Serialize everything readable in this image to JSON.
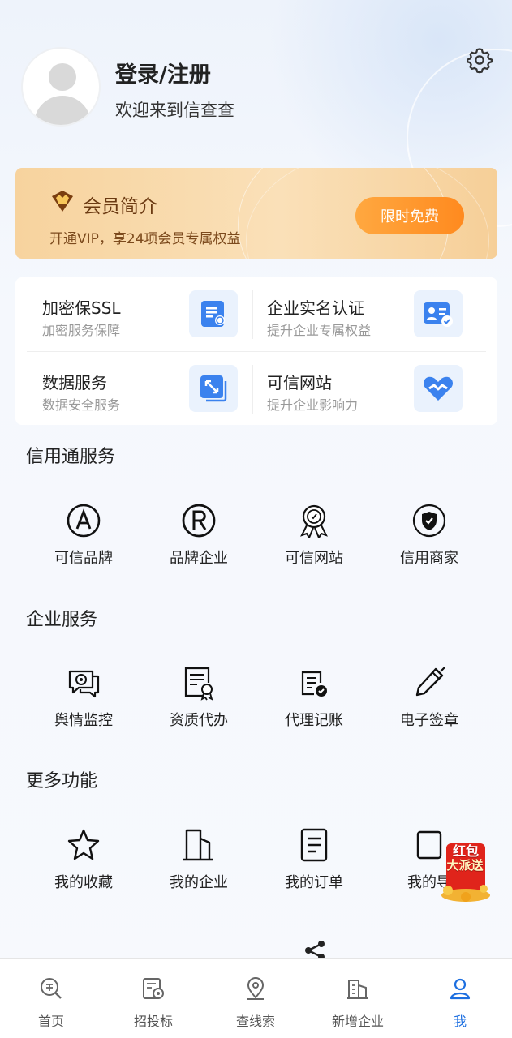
{
  "header": {
    "login_title": "登录/注册",
    "welcome": "欢迎来到信查查"
  },
  "vip": {
    "title": "会员简介",
    "subtitle": "开通VIP，享24项会员专属权益",
    "button": "限时免费"
  },
  "services": [
    {
      "title": "加密保SSL",
      "subtitle": "加密服务保障",
      "icon": "ssl-document-icon"
    },
    {
      "title": "企业实名认证",
      "subtitle": "提升企业专属权益",
      "icon": "id-card-verify-icon"
    },
    {
      "title": "数据服务",
      "subtitle": "数据安全服务",
      "icon": "data-expand-icon"
    },
    {
      "title": "可信网站",
      "subtitle": "提升企业影响力",
      "icon": "heart-trust-icon"
    }
  ],
  "credit_section": {
    "title": "信用通服务",
    "items": [
      {
        "label": "可信品牌",
        "icon": "brand-a-icon"
      },
      {
        "label": "品牌企业",
        "icon": "registered-r-icon"
      },
      {
        "label": "可信网站",
        "icon": "award-ribbon-icon"
      },
      {
        "label": "信用商家",
        "icon": "shield-check-icon"
      }
    ]
  },
  "enterprise_section": {
    "title": "企业服务",
    "items": [
      {
        "label": "舆情监控",
        "icon": "chat-target-icon"
      },
      {
        "label": "资质代办",
        "icon": "certificate-icon"
      },
      {
        "label": "代理记账",
        "icon": "ledger-check-icon"
      },
      {
        "label": "电子签章",
        "icon": "pen-sign-icon"
      }
    ]
  },
  "more_section": {
    "title": "更多功能",
    "items": [
      {
        "label": "我的收藏",
        "icon": "star-icon"
      },
      {
        "label": "我的企业",
        "icon": "building-icon"
      },
      {
        "label": "我的订单",
        "icon": "order-list-icon"
      },
      {
        "label": "我的导",
        "icon": "export-icon"
      }
    ]
  },
  "promo": {
    "text_line1": "红包",
    "text_line2": "大派送"
  },
  "bottom_nav": [
    {
      "label": "首页",
      "icon": "home-search-icon",
      "active": false
    },
    {
      "label": "招投标",
      "icon": "bid-target-icon",
      "active": false
    },
    {
      "label": "查线索",
      "icon": "location-pin-icon",
      "active": false
    },
    {
      "label": "新增企业",
      "icon": "new-building-icon",
      "active": false
    },
    {
      "label": "我",
      "icon": "user-profile-icon",
      "active": true
    }
  ],
  "colors": {
    "accent": "#1d6fe0",
    "vip_button": "#ff9a2e",
    "vip_bg": "#f9dcae"
  }
}
